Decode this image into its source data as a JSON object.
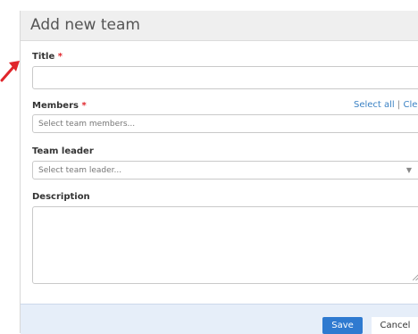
{
  "dialog": {
    "title": "Add new team",
    "fields": {
      "title": {
        "label": "Title",
        "required_mark": "*",
        "value": ""
      },
      "members": {
        "label": "Members",
        "required_mark": "*",
        "placeholder": "Select team members...",
        "select_all": "Select all",
        "separator": "|",
        "clear": "Clear"
      },
      "team_leader": {
        "label": "Team leader",
        "placeholder": "Select team leader..."
      },
      "description": {
        "label": "Description",
        "value": ""
      }
    },
    "buttons": {
      "save": "Save",
      "cancel": "Cancel"
    }
  },
  "icons": {
    "dropdown": "chevron-down-icon",
    "pointer": "red-arrow-icon"
  },
  "colors": {
    "accent": "#2f7ad0",
    "required": "#e0252b",
    "link": "#3b82c4",
    "footer": "#e6eef9"
  }
}
